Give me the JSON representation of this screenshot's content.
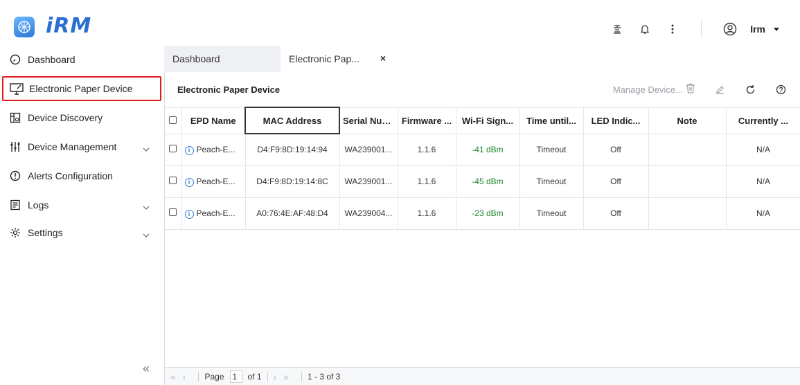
{
  "app": {
    "logo_text": "iRM"
  },
  "topbar": {
    "user_name": "Irm"
  },
  "sidebar": {
    "items": [
      {
        "label": "Dashboard"
      },
      {
        "label": "Electronic Paper Device"
      },
      {
        "label": "Device Discovery"
      },
      {
        "label": "Device Management"
      },
      {
        "label": "Alerts Configuration"
      },
      {
        "label": "Logs"
      },
      {
        "label": "Settings"
      }
    ],
    "collapse_label": "«"
  },
  "tabs": [
    {
      "label": "Dashboard"
    },
    {
      "label": "Electronic Pap..."
    }
  ],
  "panel": {
    "title": "Electronic Paper Device",
    "manage_label": "Manage Device..."
  },
  "table": {
    "headers": [
      "EPD Name",
      "MAC Address",
      "Serial Numbe",
      "Firmware ...",
      "Wi-Fi Sign...",
      "Time until...",
      "LED Indic...",
      "Note",
      "Currently ..."
    ],
    "rows": [
      {
        "name": "Peach-E...",
        "mac": "D4:F9:8D:19:14:94",
        "serial": "WA239001...",
        "firmware": "1.1.6",
        "wifi": "-41 dBm",
        "time": "Timeout",
        "led": "Off",
        "note": "",
        "current": "N/A"
      },
      {
        "name": "Peach-E...",
        "mac": "D4:F9:8D:19:14:8C",
        "serial": "WA239001...",
        "firmware": "1.1.6",
        "wifi": "-45 dBm",
        "time": "Timeout",
        "led": "Off",
        "note": "",
        "current": "N/A"
      },
      {
        "name": "Peach-E...",
        "mac": "A0:76:4E:AF:48:D4",
        "serial": "WA239004...",
        "firmware": "1.1.6",
        "wifi": "-23 dBm",
        "time": "Timeout",
        "led": "Off",
        "note": "",
        "current": "N/A"
      }
    ]
  },
  "pager": {
    "page_label": "Page",
    "page_value": "1",
    "of_label": "of 1",
    "range_label": "1 - 3 of 3"
  },
  "colors": {
    "accent": "#2b6fd3",
    "highlight_border": "#e21b1b",
    "wifi_good": "#1f8a2a"
  }
}
